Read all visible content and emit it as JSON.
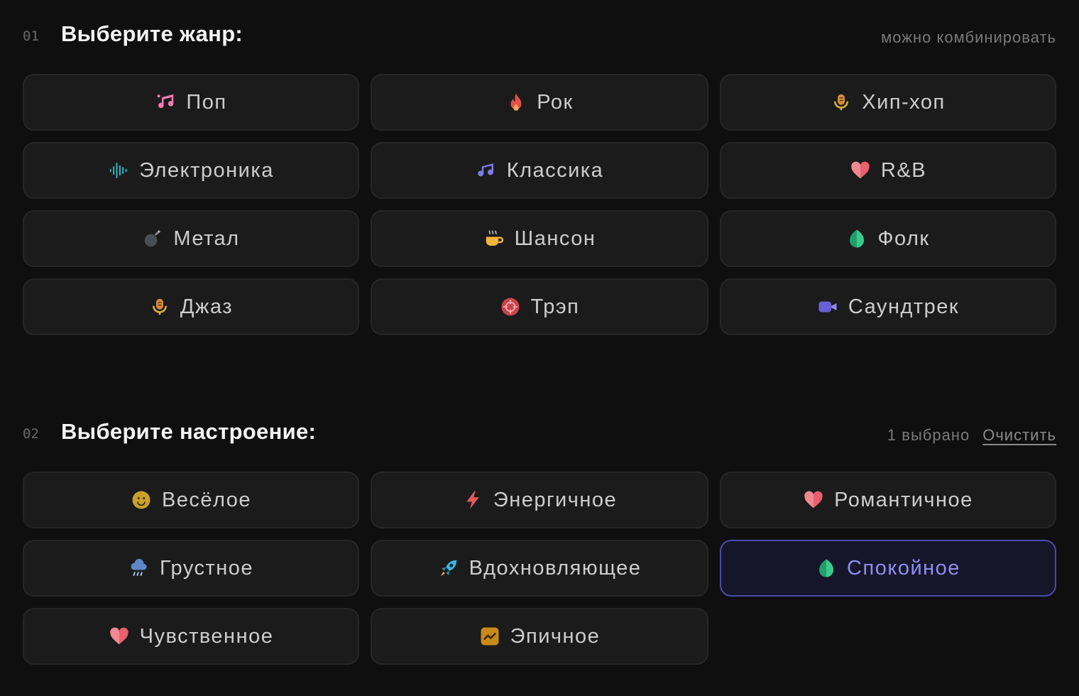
{
  "genre_section": {
    "number": "01",
    "title": "Выберите жанр:",
    "hint": "можно комбинировать",
    "items": [
      {
        "label": "Поп",
        "icon": "music-notes-icon"
      },
      {
        "label": "Рок",
        "icon": "fire-icon"
      },
      {
        "label": "Хип-хоп",
        "icon": "microphone-icon"
      },
      {
        "label": "Электроника",
        "icon": "sound-wave-icon"
      },
      {
        "label": "Классика",
        "icon": "music-note-icon"
      },
      {
        "label": "R&B",
        "icon": "heart-icon"
      },
      {
        "label": "Метал",
        "icon": "bomb-icon"
      },
      {
        "label": "Шансон",
        "icon": "hot-beverage-icon"
      },
      {
        "label": "Фолк",
        "icon": "leaf-icon"
      },
      {
        "label": "Джаз",
        "icon": "microphone-icon"
      },
      {
        "label": "Трэп",
        "icon": "crosshair-icon"
      },
      {
        "label": "Саундтрек",
        "icon": "video-camera-icon"
      }
    ]
  },
  "mood_section": {
    "number": "02",
    "title": "Выберите настроение:",
    "selected_count": "1 выбрано",
    "clear_label": "Очистить",
    "items": [
      {
        "label": "Весёлое",
        "icon": "smiley-icon",
        "selected": false
      },
      {
        "label": "Энергичное",
        "icon": "lightning-icon",
        "selected": false
      },
      {
        "label": "Романтичное",
        "icon": "heart-icon",
        "selected": false
      },
      {
        "label": "Грустное",
        "icon": "rain-cloud-icon",
        "selected": false
      },
      {
        "label": "Вдохновляющее",
        "icon": "rocket-icon",
        "selected": false
      },
      {
        "label": "Спокойное",
        "icon": "leaf-icon",
        "selected": true
      },
      {
        "label": "Чувственное",
        "icon": "heart-icon",
        "selected": false
      },
      {
        "label": "Эпичное",
        "icon": "chart-up-icon",
        "selected": false
      }
    ]
  },
  "colors": {
    "background": "#0f0f0f",
    "chip_background": "#1b1b1b",
    "chip_border": "#262626",
    "selected_background": "#16162a",
    "selected_border": "#4a4aa8",
    "selected_text": "#8e8ef2"
  }
}
